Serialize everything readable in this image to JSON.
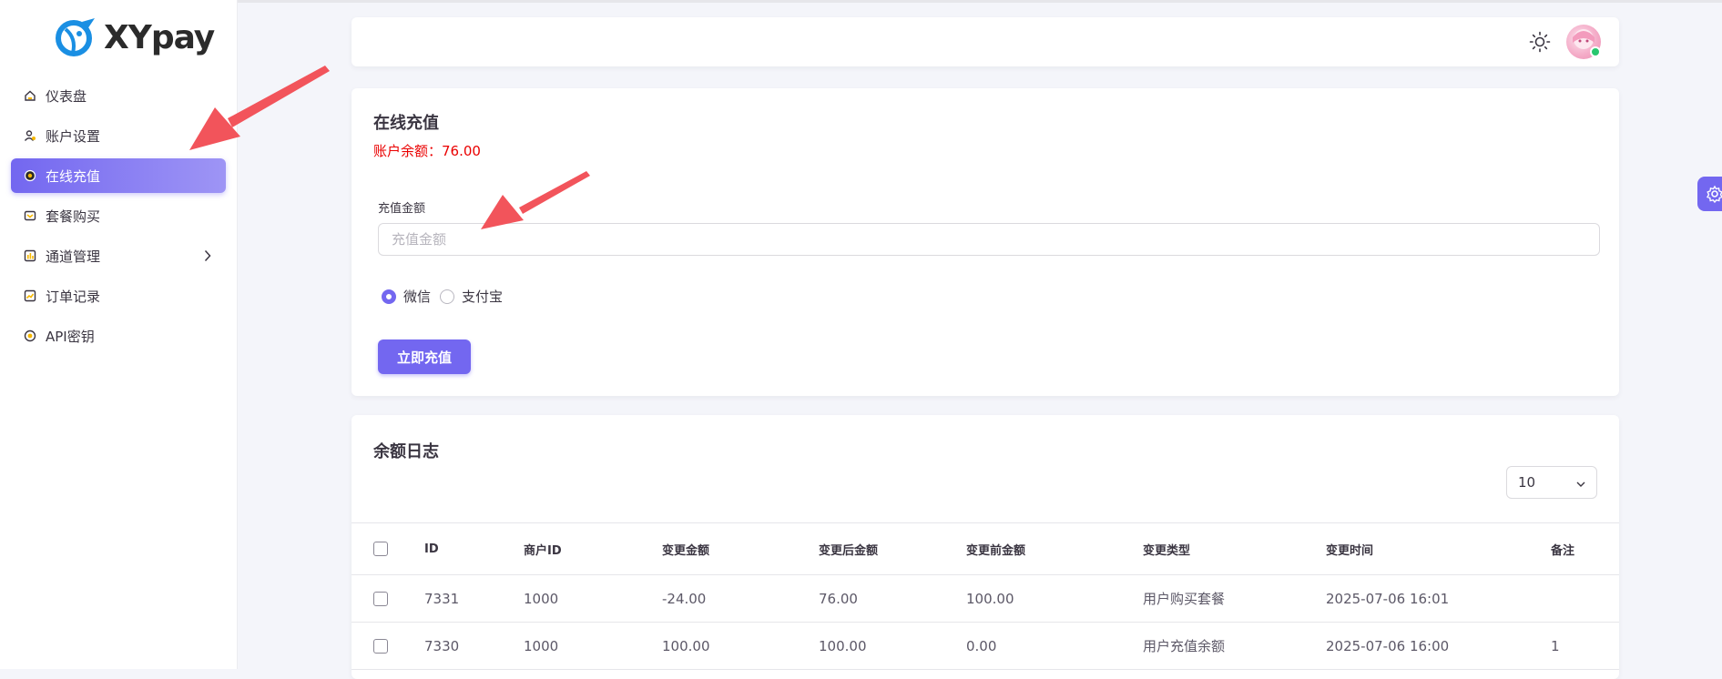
{
  "brand": {
    "name": "XYpay"
  },
  "sidebar": {
    "items": [
      {
        "label": "仪表盘",
        "icon": "dashboard-icon"
      },
      {
        "label": "账户设置",
        "icon": "user-settings-icon"
      },
      {
        "label": "在线充值",
        "icon": "recharge-icon",
        "active": true
      },
      {
        "label": "套餐购买",
        "icon": "package-icon"
      },
      {
        "label": "通道管理",
        "icon": "channel-icon",
        "has_children": true
      },
      {
        "label": "订单记录",
        "icon": "orders-icon"
      },
      {
        "label": "API密钥",
        "icon": "api-key-icon"
      }
    ]
  },
  "header": {
    "theme_icon": "sun-icon",
    "avatar": "user-avatar"
  },
  "recharge": {
    "title": "在线充值",
    "balance_text": "账户余额：76.00",
    "amount_label": "充值金额",
    "amount_placeholder": "充值金额",
    "amount_value": "",
    "payment_options": [
      {
        "label": "微信",
        "checked": true
      },
      {
        "label": "支付宝",
        "checked": false
      }
    ],
    "submit_label": "立即充值"
  },
  "log": {
    "title": "余额日志",
    "per_page": "10",
    "columns": [
      "ID",
      "商户ID",
      "变更金额",
      "变更后金额",
      "变更前金额",
      "变更类型",
      "变更时间",
      "备注"
    ],
    "rows": [
      [
        "7331",
        "1000",
        "-24.00",
        "76.00",
        "100.00",
        "用户购买套餐",
        "2025-07-06 16:01",
        ""
      ],
      [
        "7330",
        "1000",
        "100.00",
        "100.00",
        "0.00",
        "用户充值余额",
        "2025-07-06 16:00",
        "1"
      ]
    ]
  },
  "colors": {
    "accent": "#7367f0",
    "balance": "#ea0000",
    "annotation_arrow": "#f2545b"
  }
}
